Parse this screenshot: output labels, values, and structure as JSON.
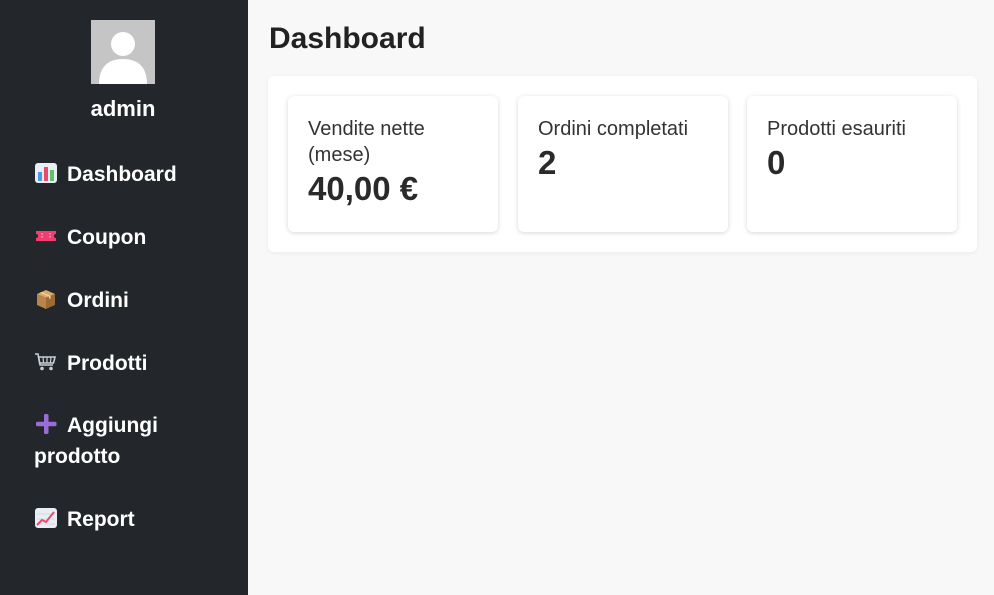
{
  "sidebar": {
    "username": "admin",
    "items": [
      {
        "label": "Dashboard",
        "icon": "bar-chart-icon"
      },
      {
        "label": "Coupon",
        "icon": "ticket-icon"
      },
      {
        "label": "Ordini",
        "icon": "package-icon"
      },
      {
        "label": "Prodotti",
        "icon": "shopping-cart-icon"
      },
      {
        "label": "Aggiungi prodotto",
        "icon": "plus-icon"
      },
      {
        "label": "Report",
        "icon": "line-chart-icon"
      }
    ]
  },
  "main": {
    "title": "Dashboard",
    "cards": [
      {
        "label": "Vendite nette (mese)",
        "value": "40,00 €"
      },
      {
        "label": "Ordini completati",
        "value": "2"
      },
      {
        "label": "Prodotti esauriti",
        "value": "0"
      }
    ]
  },
  "colors": {
    "sidebar_bg": "#23272b",
    "main_bg": "#f8f8f8",
    "card_bg": "#ffffff",
    "avatar_bg": "#c5c5c5"
  }
}
